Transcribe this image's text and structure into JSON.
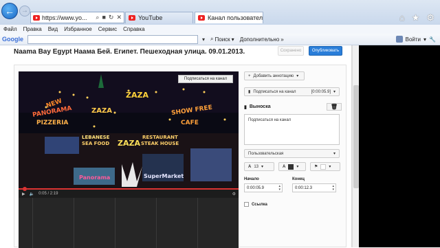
{
  "browser": {
    "address": "https://www.yo...",
    "tabs": [
      {
        "label": "YouTube",
        "active": false
      },
      {
        "label": "Канал пользователя к...",
        "active": true
      }
    ],
    "menu": [
      "Файл",
      "Правка",
      "Вид",
      "Избранное",
      "Сервис",
      "Справка"
    ],
    "toolbar": {
      "google": "Google",
      "search_btn": "Поиск",
      "more": "Дополнительно",
      "login": "Войти"
    }
  },
  "page": {
    "title": "Naama Bay Egypt Наама Бей. Египет. Пешеходная улица. 09.01.2013.",
    "save": "Сохранено",
    "publish": "Опубликовать"
  },
  "video": {
    "subscribe_chip": "Подписаться на канал",
    "time": "0:05 / 2:19",
    "signs": [
      "NEW",
      "PANORAMA",
      "PIZZERIA",
      "ZAZA",
      "ZAZA",
      "SHOW FREE",
      "CAFE",
      "LEBANESE",
      "SEA FOOD",
      "ZAZA",
      "RESTAURANT",
      "STEAK HOUSE",
      "Panorama",
      "SuperMarket"
    ]
  },
  "annotations": {
    "add_annotation": "Добавить аннотацию",
    "current_annotation": "Подписаться на канал",
    "current_time": "[0:00:05.9]",
    "section_title": "Выноска",
    "text": "Подписаться на канал",
    "link_type": "Пользовательская",
    "font_size": "13",
    "start_label": "Начало",
    "end_label": "Конец",
    "start_value": "0:00:05.9",
    "end_value": "0:00:12.3",
    "link_label": "Ссылка"
  },
  "colors": {
    "publish": "#2a7ed9",
    "progress": "#dd3333"
  }
}
